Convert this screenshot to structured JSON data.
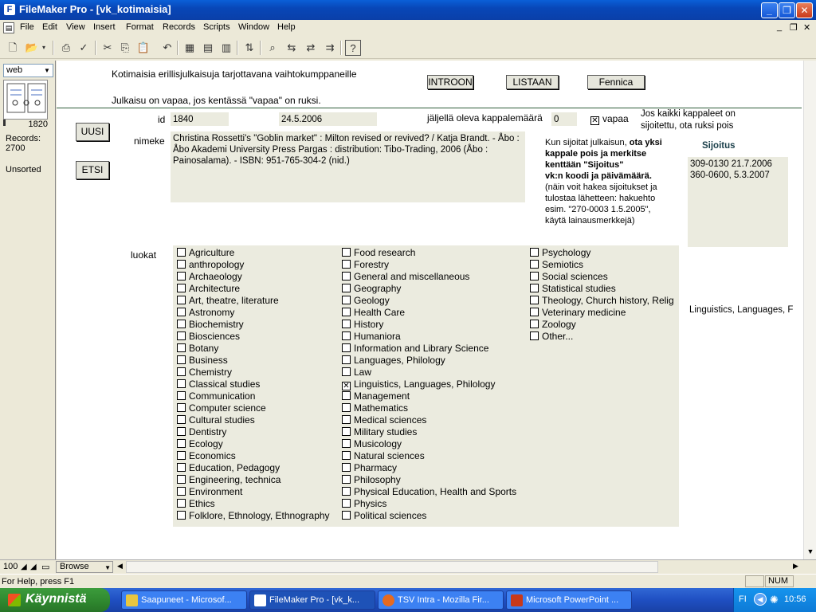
{
  "window": {
    "title": "FileMaker Pro - [vk_kotimaisia]",
    "minimize": "_",
    "maximize": "❐",
    "close": "✕"
  },
  "menu": [
    "File",
    "Edit",
    "View",
    "Insert",
    "Format",
    "Records",
    "Scripts",
    "Window",
    "Help"
  ],
  "status_panel": {
    "layout": "web",
    "record_number": "1820",
    "records_label": "Records:",
    "records_count": "2700",
    "sort_state": "Unsorted"
  },
  "header": {
    "line1": "Kotimaisia erillisjulkaisuja tarjottavana vaihtokumppaneille",
    "line2": "Julkaisu on vapaa, jos kentässä \"vapaa\" on ruksi.",
    "buttons": {
      "introon": "INTROON",
      "listaan": "LISTAAN",
      "fennica": "Fennica"
    }
  },
  "side_buttons": {
    "uusi": "UUSI",
    "etsi": "ETSI"
  },
  "record": {
    "id_label": "id",
    "id_value": "1840",
    "date_value": "24.5.2006",
    "remaining_label": "jäljellä oleva kappalemäärä",
    "remaining_value": "0",
    "vapaa_label": "vapaa",
    "vapaa_checked": true,
    "vapaa_note_1": "Jos kaikki kappaleet on",
    "vapaa_note_2": "sijoitettu, ota ruksi pois",
    "nimeke_label": "nimeke",
    "nimeke_value": "Christina Rossetti's \"Goblin market\" : Milton revised or revived? / Katja Brandt. - Åbo : Åbo Akademi University Press Pargas : distribution: Tibo-Trading, 2006 (Åbo : Painosalama). - ISBN: 951-765-304-2 (nid.)",
    "instructions": {
      "line1_plain": "Kun sijoitat julkaisun, ",
      "line1_bold": "ota yksi",
      "line2": "kappale pois ja merkitse",
      "line3": "kenttään \"Sijoitus\"",
      "line4": "vk:n koodi ja päivämäärä.",
      "line5": "(näin voit hakea sijoitukset ja",
      "line6": "tulostaa lähetteen: hakuehto",
      "line7": "esim. \"270-0003 1.5.2005\",",
      "line8": "käytä lainausmerkkejä)"
    },
    "sijoitus_label": "Sijoitus",
    "sijoitus_values": [
      "309-0130 21.7.2006",
      "360-0600,  5.3.2007"
    ],
    "luokat_label": "luokat",
    "luokat_summary": "Linguistics, Languages, F"
  },
  "categories": {
    "col1": [
      "Agriculture",
      "anthropology",
      "Archaeology",
      "Architecture",
      "Art, theatre, literature",
      "Astronomy",
      "Biochemistry",
      "Biosciences",
      "Botany",
      "Business",
      "Chemistry",
      "Classical studies",
      "Communication",
      "Computer science",
      "Cultural studies",
      "Dentistry",
      "Ecology",
      "Economics",
      "Education, Pedagogy",
      "Engineering, technica",
      "Environment",
      "Ethics",
      "Folklore, Ethnology, Ethnography"
    ],
    "col2": [
      "Food research",
      "Forestry",
      "General and miscellaneous",
      "Geography",
      "Geology",
      "Health Care",
      "History",
      "Humaniora",
      "Information and Library Science",
      "Languages, Philology",
      "Law",
      "Linguistics, Languages, Philology",
      "Management",
      "Mathematics",
      "Medical sciences",
      "Military studies",
      "Musicology",
      "Natural sciences",
      "Pharmacy",
      "Philosophy",
      "Physical Education, Health and Sports",
      "Physics",
      "Political sciences"
    ],
    "col3": [
      "Psychology",
      "Semiotics",
      "Social sciences",
      "Statistical studies",
      "Theology, Church history, Relig",
      "Veterinary medicine",
      "Zoology",
      "Other..."
    ],
    "checked": [
      "Linguistics, Languages, Philology"
    ]
  },
  "bottom_bar": {
    "zoom": "100",
    "mode": "Browse",
    "help_text": "For Help, press F1",
    "num": "NUM"
  },
  "taskbar": {
    "start": "Käynnistä",
    "tasks": [
      "Saapuneet - Microsof...",
      "FileMaker Pro - [vk_k...",
      "TSV Intra - Mozilla Fir...",
      "Microsoft PowerPoint ..."
    ],
    "lang": "FI",
    "clock": "10:56"
  }
}
